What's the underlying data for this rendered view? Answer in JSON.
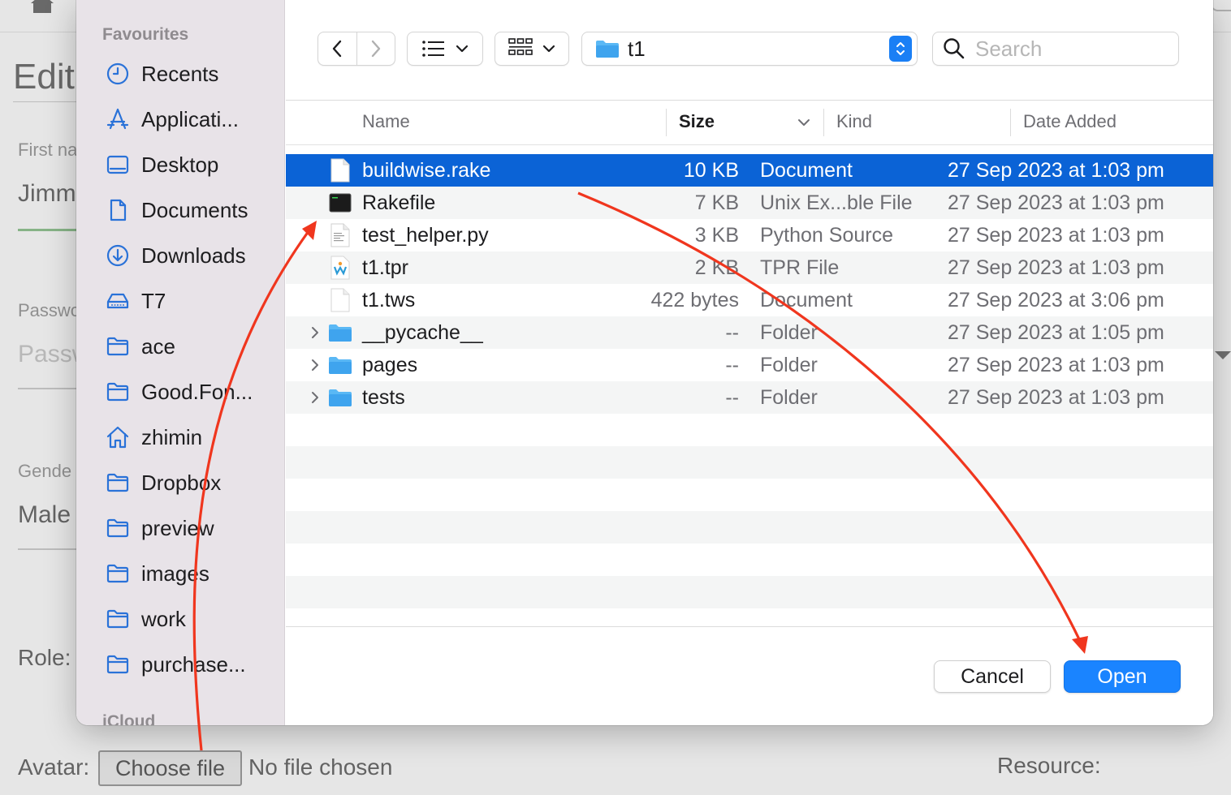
{
  "background_page": {
    "title": "Edit",
    "first_name_label": "First na",
    "first_name_value": "Jimm",
    "password_label": "Passwo",
    "password_placeholder": "Passw",
    "gender_label": "Gende",
    "gender_value": "Male",
    "role_label": "Role:",
    "avatar_label": "Avatar:",
    "choose_file_button": "Choose file",
    "no_file_text": "No file chosen",
    "resource_label": "Resource:"
  },
  "dialog": {
    "sidebar": {
      "favourites_heading": "Favourites",
      "icloud_heading": "iCloud",
      "items": [
        {
          "label": "Recents",
          "icon": "clock-icon"
        },
        {
          "label": "Applicati...",
          "icon": "applications-icon"
        },
        {
          "label": "Desktop",
          "icon": "desktop-icon"
        },
        {
          "label": "Documents",
          "icon": "document-icon"
        },
        {
          "label": "Downloads",
          "icon": "download-icon"
        },
        {
          "label": "T7",
          "icon": "drive-icon"
        },
        {
          "label": "ace",
          "icon": "folder-icon"
        },
        {
          "label": "Good.Fon...",
          "icon": "folder-icon"
        },
        {
          "label": "zhimin",
          "icon": "home-icon"
        },
        {
          "label": "Dropbox",
          "icon": "folder-icon"
        },
        {
          "label": "preview",
          "icon": "folder-icon"
        },
        {
          "label": "images",
          "icon": "folder-icon"
        },
        {
          "label": "work",
          "icon": "folder-icon"
        },
        {
          "label": "purchase...",
          "icon": "folder-icon"
        }
      ]
    },
    "toolbar": {
      "current_folder": "t1",
      "search_placeholder": "Search"
    },
    "columns": {
      "name": "Name",
      "size": "Size",
      "kind": "Kind",
      "date_added": "Date Added"
    },
    "files": [
      {
        "name": "buildwise.rake",
        "size": "10 KB",
        "kind": "Document",
        "date": "27 Sep 2023 at 1:03 pm",
        "type": "doc",
        "selected": true
      },
      {
        "name": "Rakefile",
        "size": "7 KB",
        "kind": "Unix Ex...ble File",
        "date": "27 Sep 2023 at 1:03 pm",
        "type": "exec",
        "selected": false
      },
      {
        "name": "test_helper.py",
        "size": "3 KB",
        "kind": "Python Source",
        "date": "27 Sep 2023 at 1:03 pm",
        "type": "py",
        "selected": false
      },
      {
        "name": "t1.tpr",
        "size": "2 KB",
        "kind": "TPR File",
        "date": "27 Sep 2023 at 1:03 pm",
        "type": "tpr",
        "selected": false
      },
      {
        "name": "t1.tws",
        "size": "422 bytes",
        "kind": "Document",
        "date": "27 Sep 2023 at 3:06 pm",
        "type": "blank",
        "selected": false
      },
      {
        "name": "__pycache__",
        "size": "--",
        "kind": "Folder",
        "date": "27 Sep 2023 at 1:05 pm",
        "type": "folder",
        "selected": false
      },
      {
        "name": "pages",
        "size": "--",
        "kind": "Folder",
        "date": "27 Sep 2023 at 1:03 pm",
        "type": "folder",
        "selected": false
      },
      {
        "name": "tests",
        "size": "--",
        "kind": "Folder",
        "date": "27 Sep 2023 at 1:03 pm",
        "type": "folder",
        "selected": false
      }
    ],
    "buttons": {
      "cancel": "Cancel",
      "open": "Open"
    }
  },
  "colors": {
    "selection": "#0b63d6",
    "primary_button": "#1a84ff",
    "sidebar_bg": "#e8e3e8",
    "sidebar_icon": "#2a72d8",
    "annotation_arrow": "#f0361e"
  }
}
